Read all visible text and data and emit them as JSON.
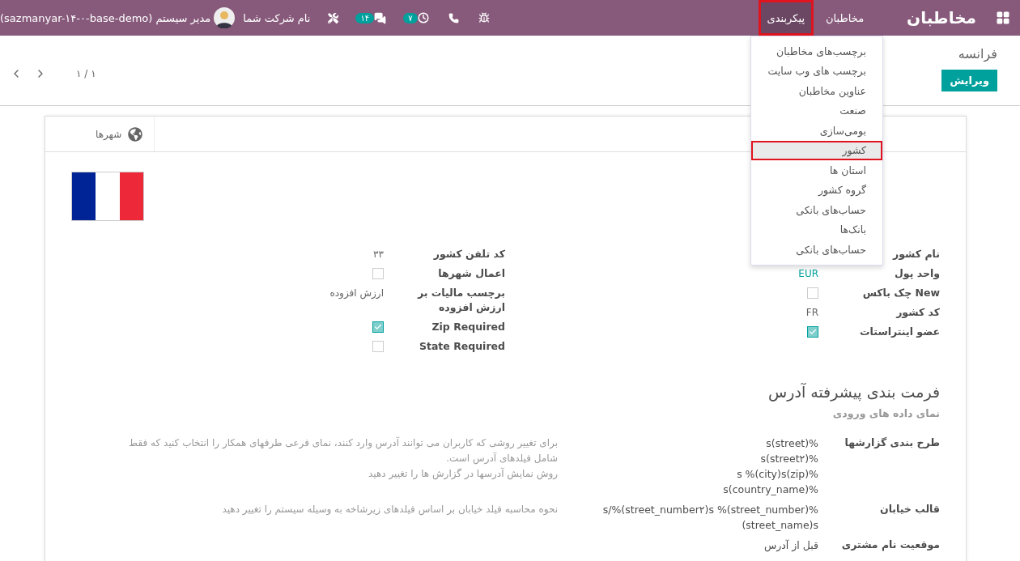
{
  "navbar": {
    "app_name": "مخاطبان",
    "menu": [
      {
        "label": "مخاطبان",
        "selected": false
      },
      {
        "label": "پیکربندی",
        "selected": true
      }
    ],
    "activity_badge": "۷",
    "messages_badge": "۱۴",
    "company": "نام شرکت شما",
    "user": "مدیر سیستم (sazmanyar-۱۴-۰-base-demo)"
  },
  "dropdown": {
    "items": [
      {
        "label": "برچسب‌های مخاطبان",
        "selected": false
      },
      {
        "label": "برچسب های وب سایت",
        "selected": false
      },
      {
        "label": "عناوین مخاطبان",
        "selected": false
      },
      {
        "label": "صنعت",
        "selected": false
      },
      {
        "label": "بومی‌سازی",
        "selected": false
      },
      {
        "label": "کشور",
        "selected": true
      },
      {
        "label": "استان ها",
        "selected": false
      },
      {
        "label": "گروه کشور",
        "selected": false
      },
      {
        "label": "حساب‌های بانکی",
        "selected": false
      },
      {
        "label": "بانک‌ها",
        "selected": false
      },
      {
        "label": "حساب‌های بانکی",
        "selected": false
      }
    ]
  },
  "control_panel": {
    "breadcrumb": "فرانسه",
    "edit_button": "ویرایش",
    "pager": "۱ / ۱"
  },
  "sheet": {
    "smart_buttons": [
      {
        "label": "شهرها"
      }
    ],
    "fields_right": [
      {
        "label": "نام کشور",
        "kind": "text"
      },
      {
        "label": "واحد پول",
        "kind": "link",
        "value": "EUR"
      },
      {
        "label": "New چک باکس",
        "kind": "checkbox",
        "checked": false
      },
      {
        "label": "کد کشور",
        "kind": "text",
        "value": "FR"
      },
      {
        "label": "عضو اینتراستات",
        "kind": "checkbox",
        "checked": true
      }
    ],
    "fields_left": [
      {
        "label": "کد تلفن کشور",
        "kind": "text",
        "value": "۳۳"
      },
      {
        "label": "اعمال شهرها",
        "kind": "checkbox",
        "checked": false
      },
      {
        "label": "برچسب مالیات بر ارزش افزوده",
        "kind": "text",
        "value": "ارزش افزوده"
      },
      {
        "label": "Zip Required",
        "kind": "checkbox",
        "checked": true
      },
      {
        "label": "State Required",
        "kind": "checkbox",
        "checked": false
      }
    ],
    "address": {
      "title": "فرمت بندی پیشرفته آدرس",
      "subtitle": "نمای داده های ورودی",
      "rows": [
        {
          "label": "طرح بندی گزارشها",
          "lines": [
            "s(street)%",
            "s(street۲)%",
            "s %(city)s(zip)%",
            "s(country_name)%"
          ],
          "help": [
            "برای تغییر روشی که کاربران می توانند آدرس وارد کنند، نمای فرعی طرفهای همکار را انتخاب کنید که فقط شامل فیلدهای آدرس است.",
            "روش نمایش آدرسها در گزارش ها را تغییر دهید"
          ]
        },
        {
          "label": "قالب خیابان",
          "lines": [
            "s/%(street_number۲)s %(street_number)%",
            "(street_name)s"
          ],
          "help": [
            "نحوه محاسبه فیلد خیابان بر اساس فیلدهای زیرشاخه به وسیله سیستم را تغییر دهید"
          ]
        },
        {
          "label": "موقعیت نام مشتری",
          "lines": [
            "قبل از آدرس"
          ],
          "help": []
        }
      ]
    }
  }
}
